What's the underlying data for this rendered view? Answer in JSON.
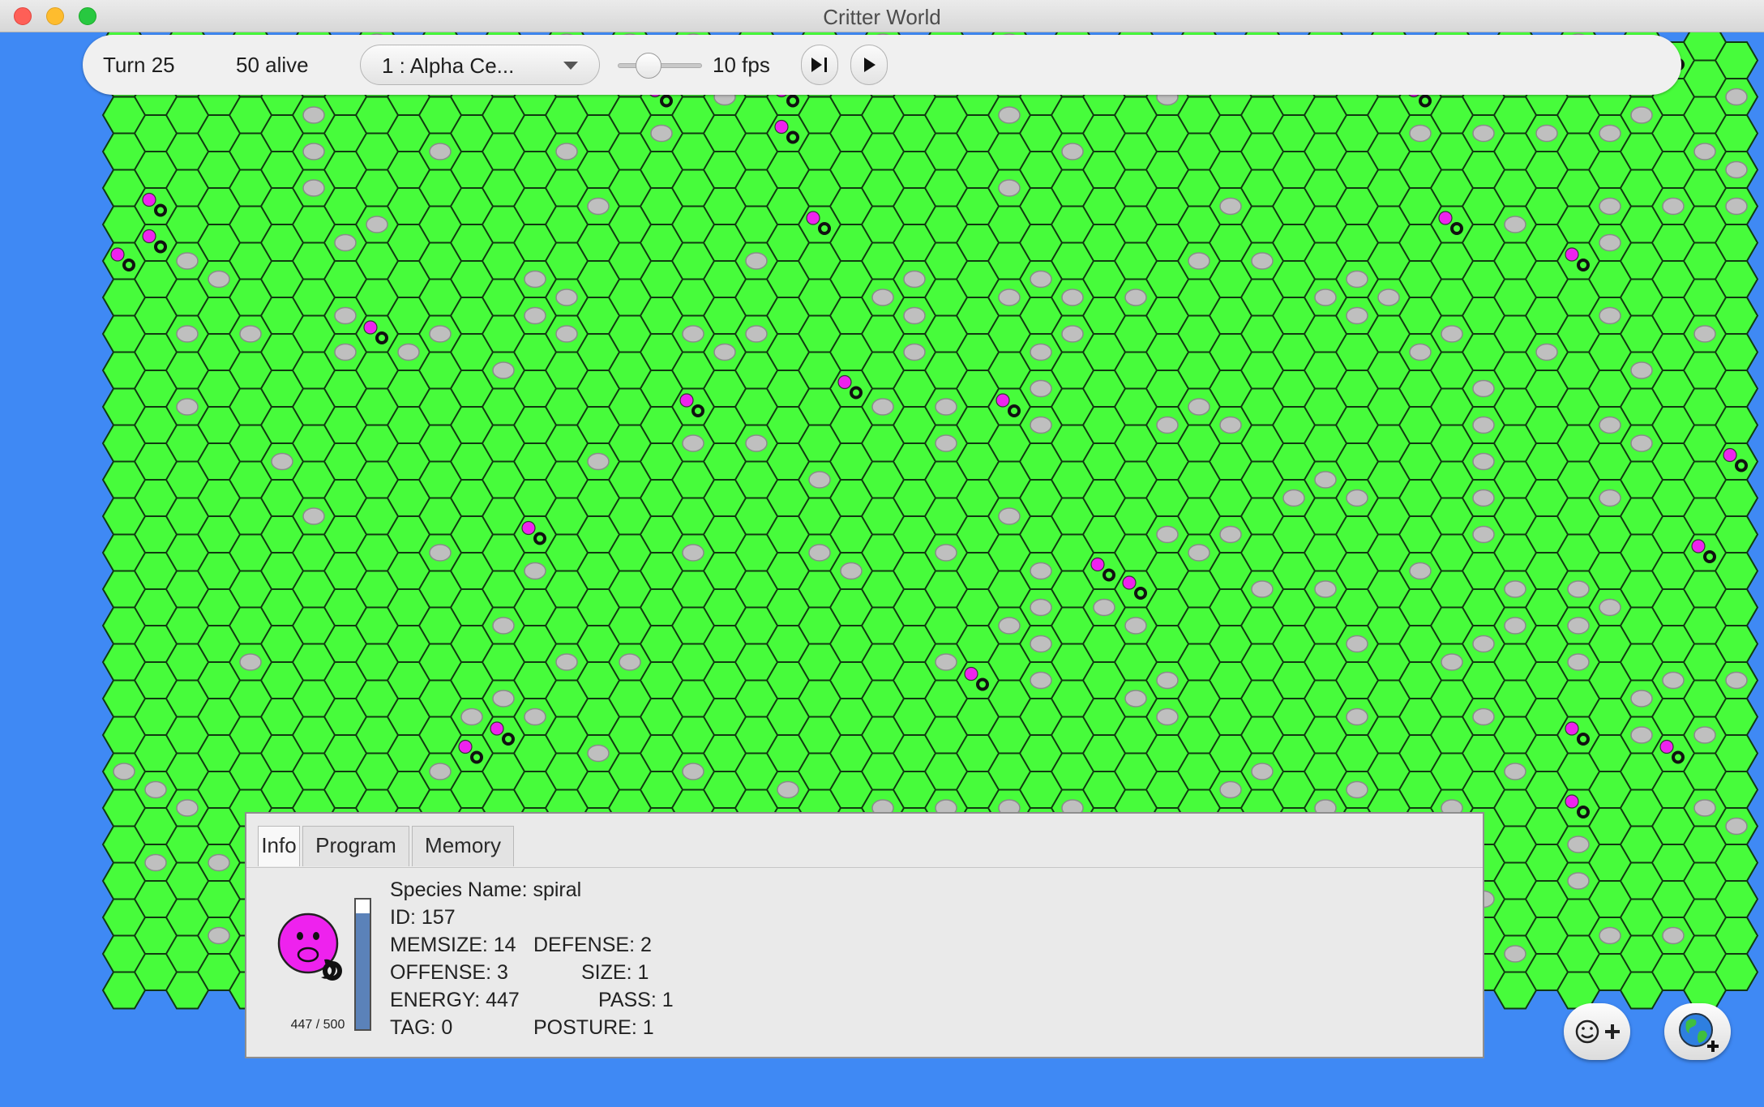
{
  "window": {
    "title": "Critter World"
  },
  "toolbar": {
    "turn": "Turn 25",
    "alive": "50 alive",
    "species": "1 : Alpha Ce...",
    "fps": "10 fps",
    "speed_level": 0.3,
    "step_icon": "step-forward-icon",
    "play_icon": "play-icon"
  },
  "colors": {
    "ocean": "#3f89f4",
    "grass": "#47fc3b",
    "hex_border": "#103a10",
    "rock": "#bfbfbf",
    "critter": "#ee22ee"
  },
  "panel": {
    "tabs": [
      "Info",
      "Program",
      "Memory"
    ],
    "active_tab": "Info",
    "energy_label": "447 / 500",
    "energy_fraction": 0.894,
    "info": {
      "species": "Species Name: spiral",
      "id": "ID: 157",
      "memsize": "MEMSIZE: 14",
      "defense": "DEFENSE: 2",
      "offense": "OFFENSE: 3",
      "size": "SIZE: 1",
      "energy": "ENERGY: 447",
      "pass": "PASS: 1",
      "tag": "TAG: 0",
      "posture": "POSTURE: 1"
    }
  },
  "buttons": {
    "add_critter_icon": "add-critter-icon",
    "load_world_icon": "load-world-icon"
  }
}
